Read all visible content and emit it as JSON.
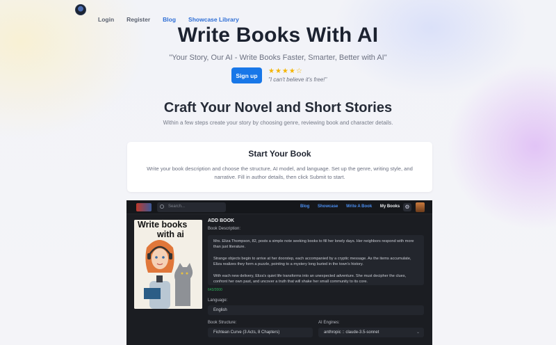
{
  "nav": {
    "login": "Login",
    "register": "Register",
    "blog": "Blog",
    "showcase": "Showcase Library"
  },
  "hero": {
    "title": "Write Books With AI",
    "tagline": "\"Your Story, Our AI - Write Books Faster, Smarter, Better with AI\"",
    "signup_label": "Sign up",
    "rating_stars": "★★★★☆",
    "rating": 4.5,
    "quote": "\"I can't believe it's free!\""
  },
  "section": {
    "title": "Craft Your Novel and Short Stories",
    "subtitle": "Within a few steps create your story by choosing genre, reviewing book and character details."
  },
  "card": {
    "title": "Start Your Book",
    "text": "Write your book description and choose the structure, AI model, and language. Set up the genre, writing style, and narrative. Fill in author details, then click Submit to start."
  },
  "app": {
    "search_placeholder": "Search...",
    "nav": {
      "blog": "Blog",
      "showcase": "Showcase",
      "write": "Write A Book",
      "my_books": "My Books"
    },
    "cover_line1": "Write books",
    "cover_line2": "with ai",
    "heading": "ADD BOOK",
    "description_label": "Book Description:",
    "description_p1": "Mrs. Eliza Thompson, 82, posts a simple note seeking books to fill her lonely days. Her neighbors respond with more than just literature.",
    "description_p2": "Strange objects begin to arrive at her doorstep, each accompanied by a cryptic message. As the items accumulate, Eliza realizes they form a puzzle, pointing to a mystery long buried in the town's history.",
    "description_p3": "With each new delivery, Eliza's quiet life transforms into an unexpected adventure. She must decipher the clues, confront her own past, and uncover a truth that will shake her small community to its core.",
    "char_counter": "643/2000",
    "language_label": "Language:",
    "language_value": "English",
    "structure_label": "Book Structure:",
    "structure_value": "Fichtean Curve (3 Acts, 8 Chapters)",
    "engines_label": "AI Engines:",
    "engines_value": "anthropic :: claude-3.5-sonnet"
  },
  "colors": {
    "accent": "#1877e8",
    "star": "#f4b400",
    "app_bg": "#1b1d22",
    "link_blue": "#2f6fd6"
  }
}
